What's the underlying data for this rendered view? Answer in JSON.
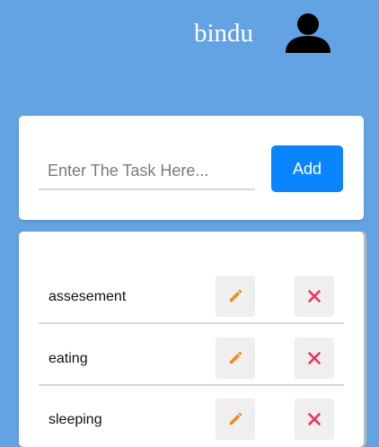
{
  "header": {
    "username": "bindu",
    "avatar_icon": "user-avatar-icon"
  },
  "task_form": {
    "input_value": "",
    "input_placeholder": "Enter The Task Here...",
    "add_label": "Add"
  },
  "tasks": [
    {
      "label": "assesement"
    },
    {
      "label": "eating"
    },
    {
      "label": "sleeping"
    }
  ],
  "icons": {
    "edit": "pencil-icon",
    "delete": "close-icon"
  },
  "colors": {
    "background": "#64a3e3",
    "accent": "#0a84ff",
    "edit_icon": "#f08a1c",
    "delete_icon": "#e8325a"
  }
}
